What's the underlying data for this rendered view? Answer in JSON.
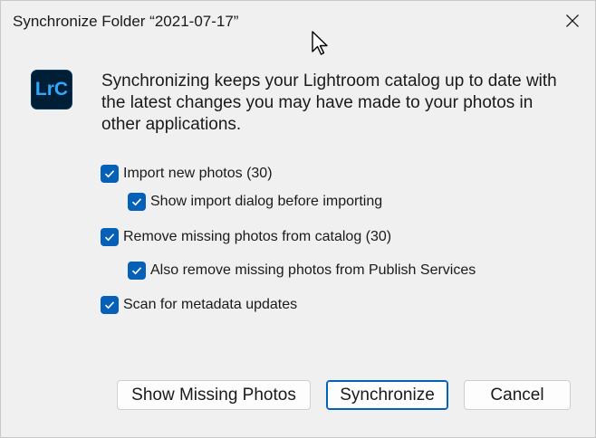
{
  "window": {
    "title": "Synchronize Folder “2021-07-17”",
    "close_icon": "close-icon"
  },
  "logo": {
    "text": "LrC",
    "icon": "lightroom-classic-logo",
    "background": "#001e36",
    "color": "#31a8ff"
  },
  "message": "Synchronizing keeps your Lightroom catalog up to date with the latest changes you may have made to your photos in other applications.",
  "options": [
    {
      "label": "Import new photos (30)",
      "checked": true
    },
    {
      "label": "Show import dialog before importing",
      "checked": true
    },
    {
      "label": "Remove missing photos from catalog (30)",
      "checked": true
    },
    {
      "label": "Also remove missing photos from Publish Services",
      "checked": true
    },
    {
      "label": "Scan for metadata updates",
      "checked": true
    }
  ],
  "buttons": {
    "show_missing": "Show Missing Photos",
    "synchronize": "Synchronize",
    "cancel": "Cancel"
  },
  "colors": {
    "accent": "#0560b8"
  }
}
